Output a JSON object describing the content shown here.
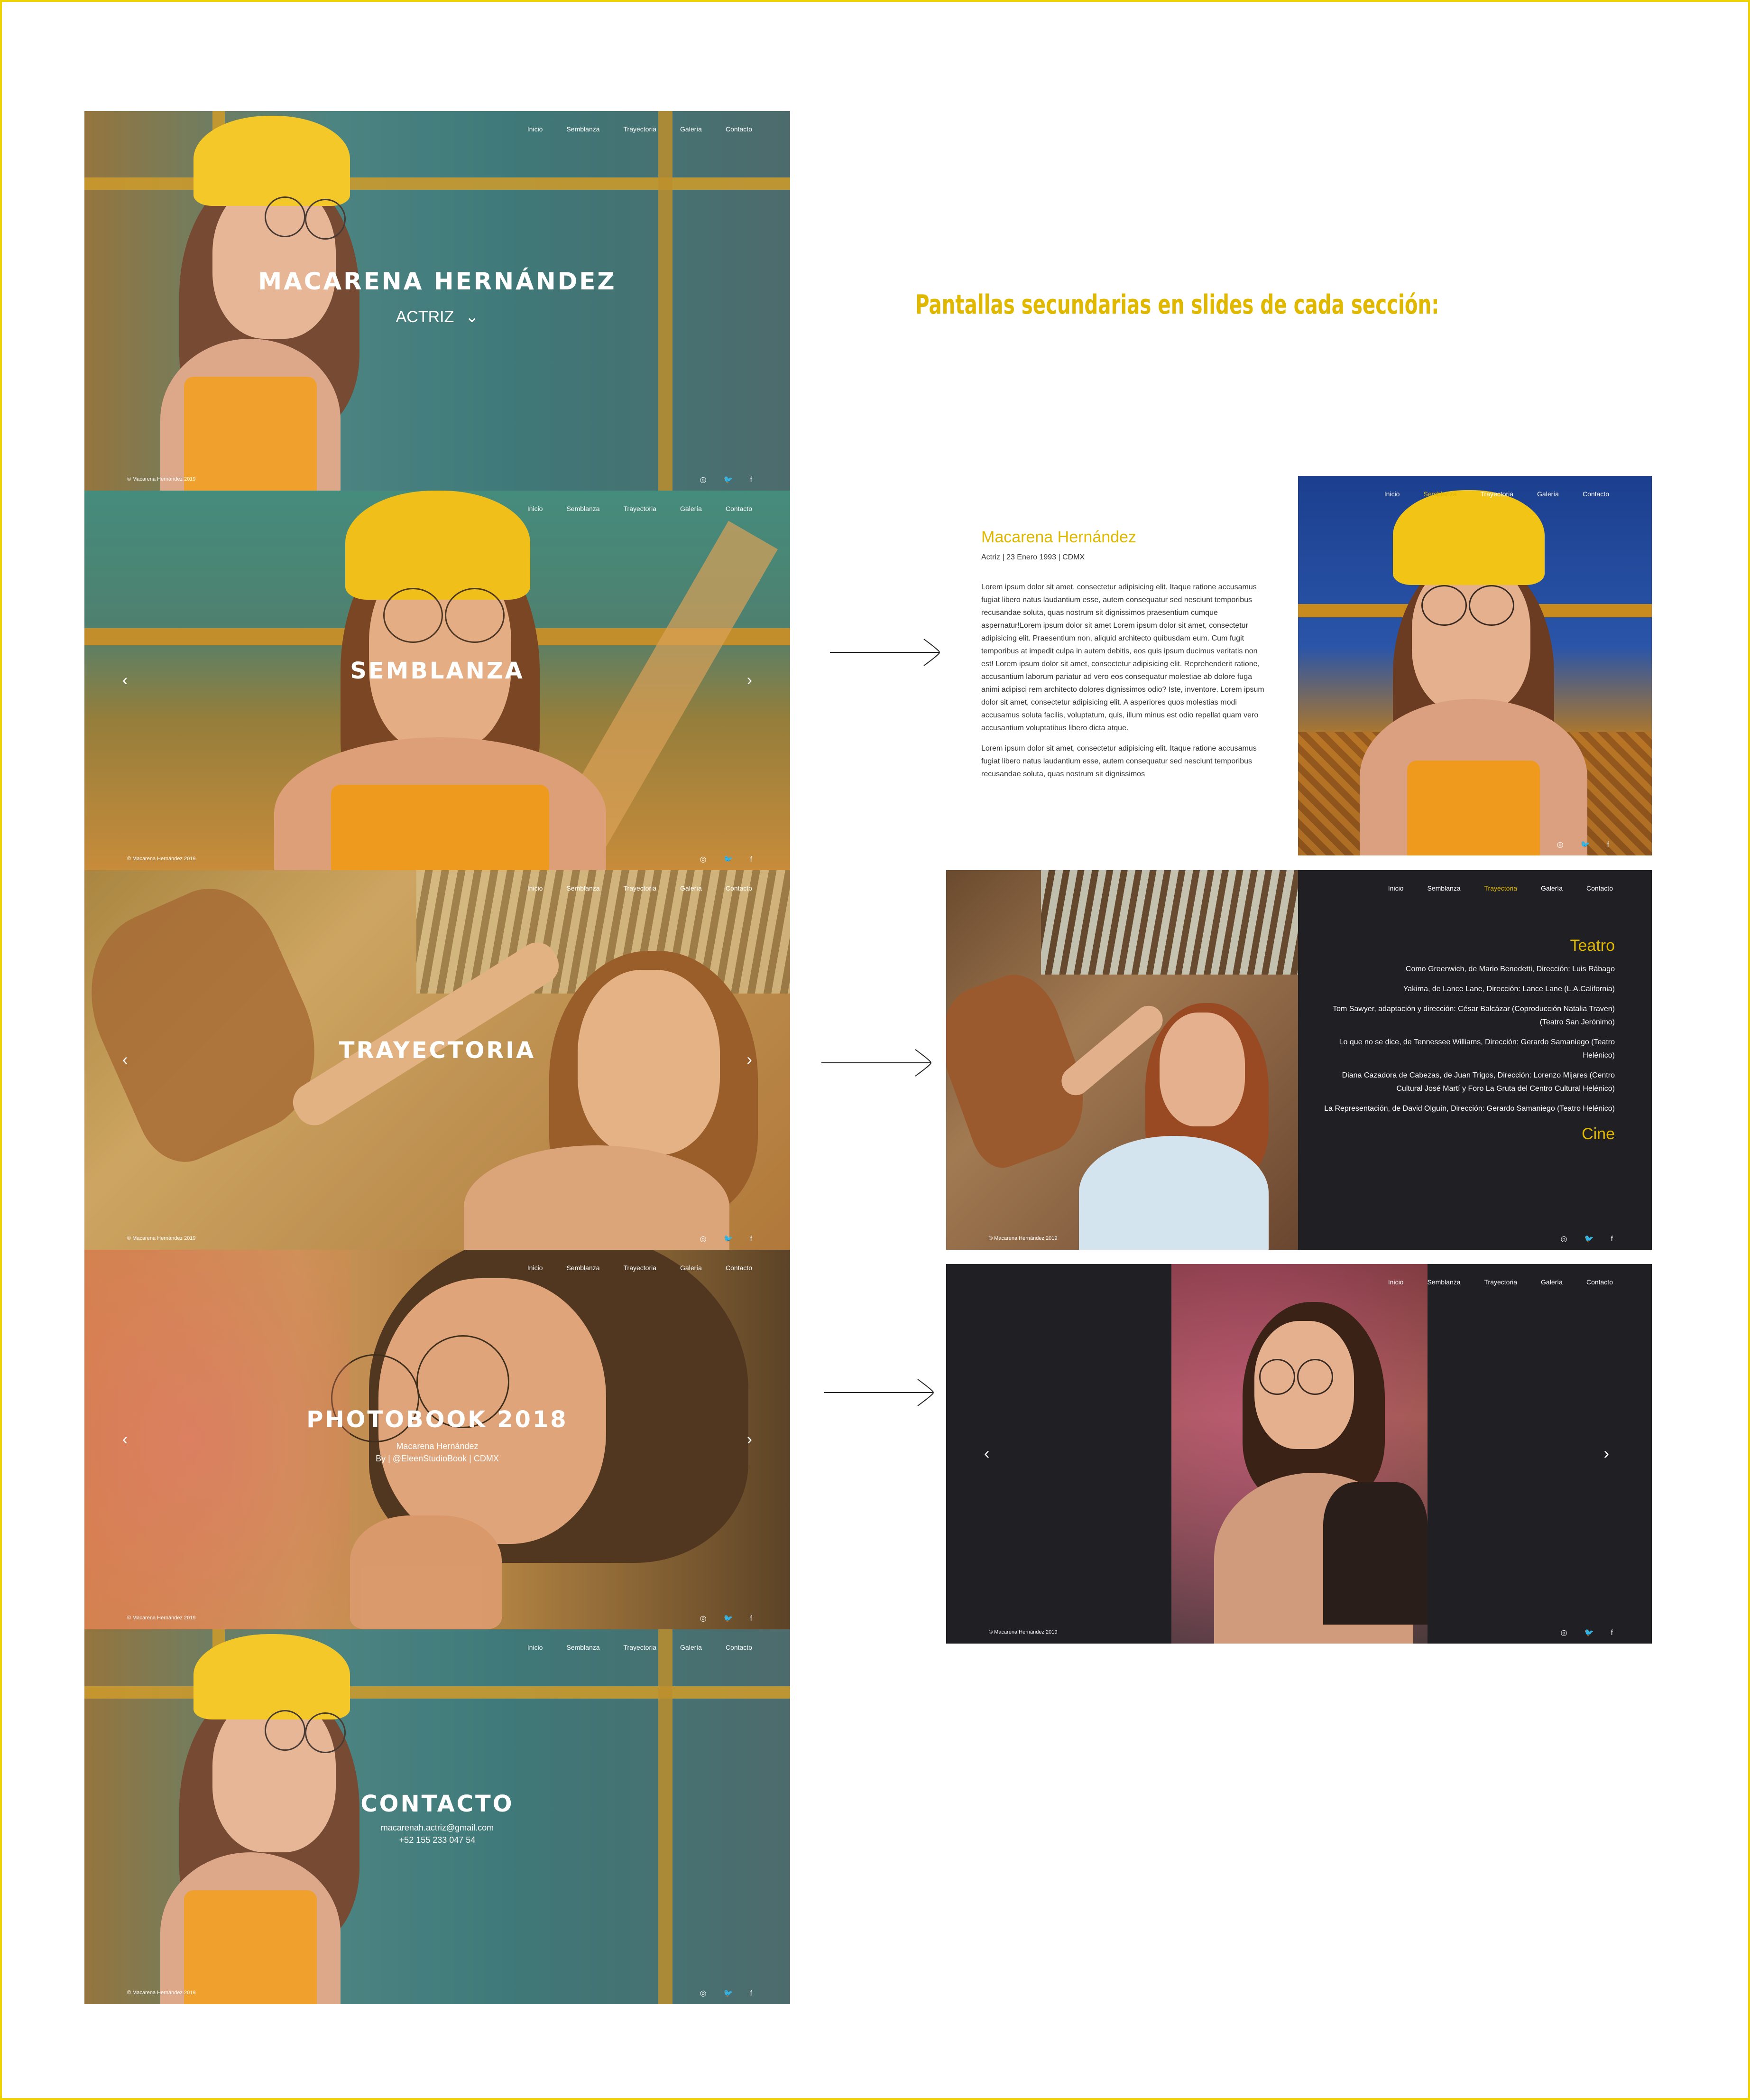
{
  "nav": [
    "Inicio",
    "Semblanza",
    "Trayectoria",
    "Galería",
    "Contacto"
  ],
  "footer_copyright": "© Macarena Hernández 2019",
  "heading": "Pantallas secundarias en slides de cada sección:",
  "icons": [
    "instagram-icon",
    "twitter-icon",
    "facebook-icon",
    "chevron-left-icon",
    "chevron-right-icon",
    "chevron-down-icon"
  ],
  "colors": {
    "accent": "#e0b800",
    "dark": "#1f1f24",
    "white": "#ffffff"
  },
  "home": {
    "name": "MACARENA HERNÁNDEZ",
    "role": "ACTRIZ"
  },
  "semblanza": {
    "title": "SEMBLANZA"
  },
  "trayectoria": {
    "title": "TRAYECTORIA"
  },
  "photobook": {
    "title": "PHOTOBOOK 2018",
    "subtitle": "Macarena Hernández",
    "credit": "By | @EleenStudioBook | CDMX"
  },
  "contacto": {
    "title": "CONTACTO",
    "email": "macarenah.actriz@gmail.com",
    "phone": "+52 155 233 047 54"
  },
  "semblanza_detail": {
    "name": "Macarena Hernández",
    "meta": "Actriz | 23 Enero 1993 | CDMX",
    "paragraph1": "Lorem ipsum dolor sit amet, consectetur adipisicing elit. Itaque ratione accusamus fugiat libero natus laudantium esse, autem consequatur sed nesciunt temporibus recusandae soluta, quas nostrum sit dignissimos praesentium cumque aspernatur!Lorem ipsum dolor sit amet Lorem ipsum dolor sit amet, consectetur adipisicing elit. Praesentium non, aliquid architecto quibusdam eum. Cum fugit temporibus at impedit culpa in autem debitis, eos quis ipsum ducimus veritatis non est! Lorem ipsum dolor sit amet, consectetur adipisicing elit. Reprehenderit ratione, accusantium laborum pariatur ad vero eos consequatur molestiae ab dolore fuga animi adipisci rem architecto dolores dignissimos odio? Iste, inventore. Lorem ipsum dolor sit amet, consectetur adipisicing elit. A asperiores quos molestias modi accusamus soluta facilis, voluptatum, quis, illum minus est odio repellat quam vero accusantium voluptatibus libero dicta atque.",
    "paragraph2": "Lorem ipsum dolor sit amet, consectetur adipisicing elit. Itaque ratione accusamus fugiat libero natus laudantium esse, autem consequatur sed nesciunt temporibus recusandae soluta, quas nostrum sit dignissimos"
  },
  "trayectoria_detail": {
    "teatro_title": "Teatro",
    "items": [
      "Como Greenwich, de Mario Benedetti, Dirección: Luis Rábago",
      "Yakima, de Lance Lane, Dirección: Lance Lane (L.A.California)",
      "Tom Sawyer, adaptación y dirección: César Balcázar (Coproducción Natalia Traven) (Teatro San Jerónimo)",
      "Lo que no se dice, de Tennessee Williams, Dirección: Gerardo Samaniego (Teatro Helénico)",
      "Diana Cazadora de Cabezas, de Juan Trigos, Dirección: Lorenzo Mijares (Centro Cultural José Martí y Foro La Gruta del Centro Cultural Helénico)",
      "La Representación, de David Olguín, Dirección: Gerardo Samaniego (Teatro Helénico)"
    ],
    "cine_title": "Cine"
  }
}
